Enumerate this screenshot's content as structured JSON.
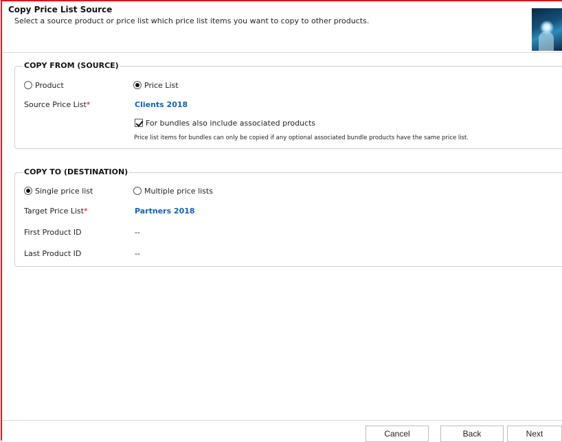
{
  "header": {
    "title": "Copy Price List Source",
    "subtitle": "Select a source product or price list which price list items you want to copy to other products."
  },
  "source": {
    "legend": "COPY FROM (SOURCE)",
    "radio_product": "Product",
    "radio_price_list": "Price List",
    "selected": "Price List",
    "source_label": "Source Price List",
    "required_mark": "*",
    "source_value": "Clients 2018",
    "checkbox_label": "For bundles also include associated products",
    "checkbox_checked": true,
    "note": "Price list items for bundles can only be copied if any optional associated bundle products have the same price list."
  },
  "destination": {
    "legend": "COPY TO (DESTINATION)",
    "radio_single": "Single price list",
    "radio_multiple": "Multiple price lists",
    "selected": "Single price list",
    "target_label": "Target Price List",
    "required_mark": "*",
    "target_value": "Partners 2018",
    "first_label": "First Product ID",
    "first_value": "--",
    "last_label": "Last Product ID",
    "last_value": "--"
  },
  "footer": {
    "cancel": "Cancel",
    "back": "Back",
    "next": "Next"
  },
  "colors": {
    "window_border": "#e0151a",
    "link": "#1160b7",
    "required": "#d0021b"
  }
}
